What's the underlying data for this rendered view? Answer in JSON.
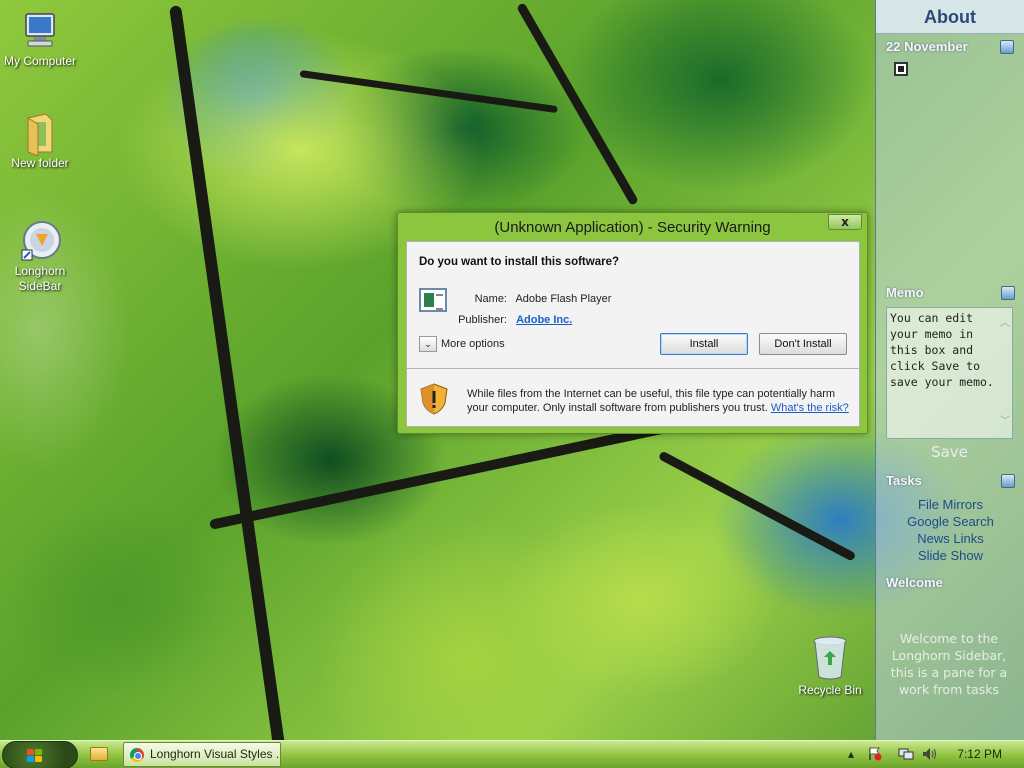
{
  "desktop": {
    "icons": [
      {
        "label": "My Computer"
      },
      {
        "label": "New folder"
      },
      {
        "label": "Longhorn\nSideBar"
      }
    ],
    "recycle_bin": "Recycle Bin"
  },
  "sidebar": {
    "about": "About",
    "calendar_date": "22 November",
    "memo_title": "Memo",
    "memo_text": "You can edit your memo in this box and click Save to save your memo.",
    "save_label": "Save",
    "tasks_title": "Tasks",
    "tasks": [
      "File Mirrors",
      "Google Search",
      "News Links",
      "Slide Show"
    ],
    "welcome_title": "Welcome",
    "welcome_text": "Welcome to the Longhorn Sidebar, this is a pane for a work from tasks"
  },
  "dialog": {
    "title": "(Unknown Application) - Security Warning",
    "close_label": "x",
    "question": "Do you want to install this software?",
    "name_label": "Name:",
    "name_value": "Adobe Flash Player",
    "publisher_label": "Publisher:",
    "publisher_value": "Adobe Inc.",
    "more_options": "More options",
    "install": "Install",
    "dont_install": "Don't Install",
    "warning_text": "While files from the Internet can be useful, this file type can potentially harm your computer. Only install software from publishers you trust.",
    "risk_link": "What's the risk?"
  },
  "taskbar": {
    "window_button": "Longhorn Visual Styles ...",
    "clock": "7:12 PM"
  },
  "colors": {
    "dialog_frame": "#8cc63f",
    "taskbar": "#8fc140",
    "link": "#1a5ec8",
    "sidebar_link": "#1d4c88"
  }
}
